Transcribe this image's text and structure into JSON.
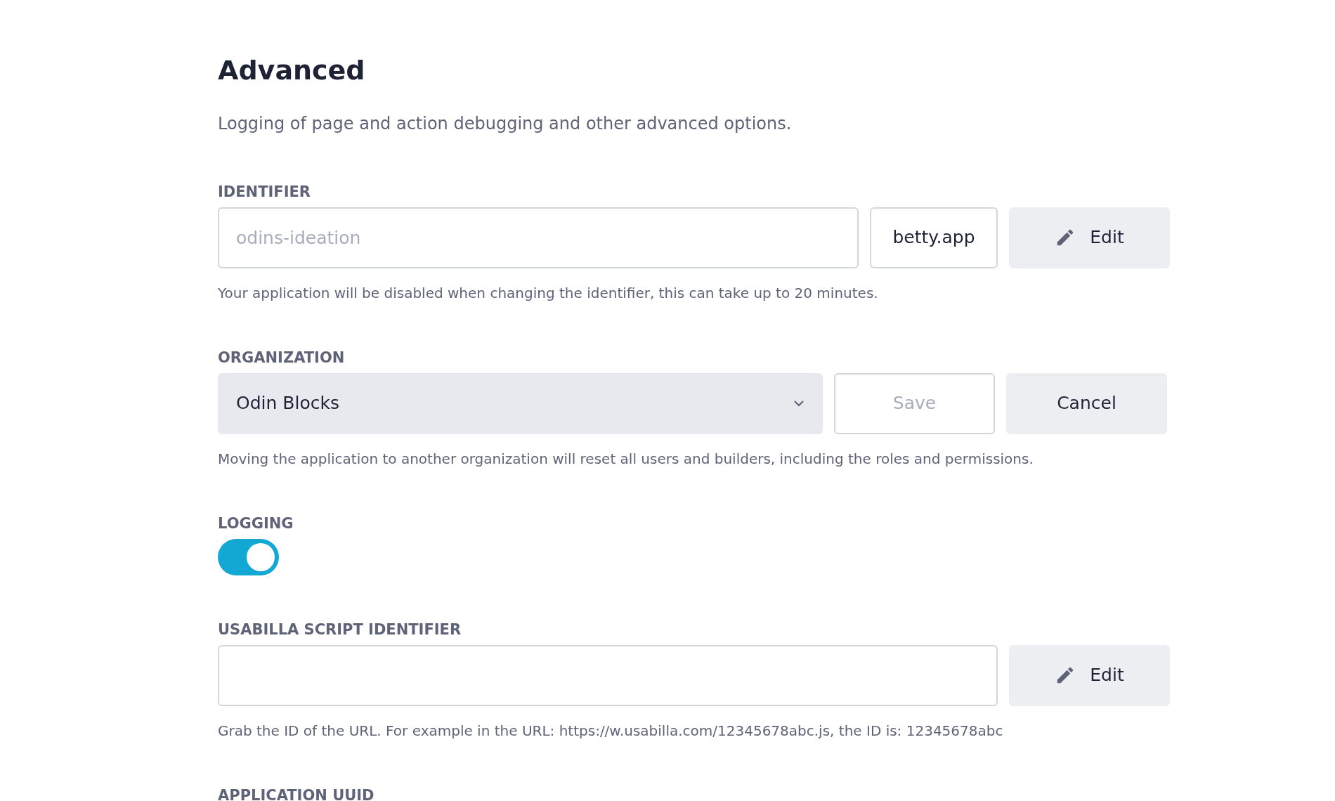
{
  "heading": "Advanced",
  "description": "Logging of page and action debugging and other advanced options.",
  "sections": [
    {
      "kind": "text",
      "label": "IDENTIFIER",
      "field": {
        "placeholder": "odins-ideation"
      },
      "suffix": "betty.app",
      "buttons": [
        {
          "label": "Edit",
          "kind": "edit",
          "disabled": false
        }
      ],
      "help": "Your application will be disabled when changing the identifier, this can take up to 20 minutes."
    },
    {
      "kind": "select",
      "label": "ORGANIZATION",
      "field": {
        "value": "Odin Blocks"
      },
      "buttons": [
        {
          "label": "Save",
          "kind": "plain",
          "disabled": true
        },
        {
          "label": "Cancel",
          "kind": "plain",
          "disabled": false
        }
      ],
      "help": "Moving the application to another organization will reset all users and builders, including the roles and permissions."
    },
    {
      "kind": "toggle",
      "label": "LOGGING",
      "on": true
    },
    {
      "kind": "text",
      "label": "USABILLA SCRIPT IDENTIFIER",
      "buttons": [
        {
          "label": "Edit",
          "kind": "edit",
          "disabled": false
        }
      ],
      "help": "Grab the ID of the URL. For example in the URL: https://w.usabilla.com/12345678abc.js, the ID is: 12345678abc"
    },
    {
      "kind": "heading",
      "label": "APPLICATION UUID"
    }
  ]
}
